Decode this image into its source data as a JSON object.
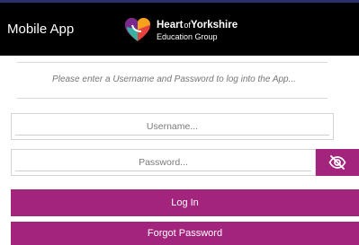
{
  "header": {
    "app_title": "Mobile App",
    "logo": {
      "line1_bold_a": "Heart",
      "line1_of": "of",
      "line1_bold_b": "Yorkshire",
      "line2": "Education Group"
    }
  },
  "login": {
    "instructions": "Please enter a Username and Password to log into the App...",
    "username_placeholder": "Username...",
    "password_placeholder": "Password...",
    "show_password_icon": "eye-off-icon",
    "login_label": "Log In",
    "forgot_label": "Forgot Password"
  },
  "colors": {
    "header_bg": "#000000",
    "accent": "#a3247c"
  }
}
